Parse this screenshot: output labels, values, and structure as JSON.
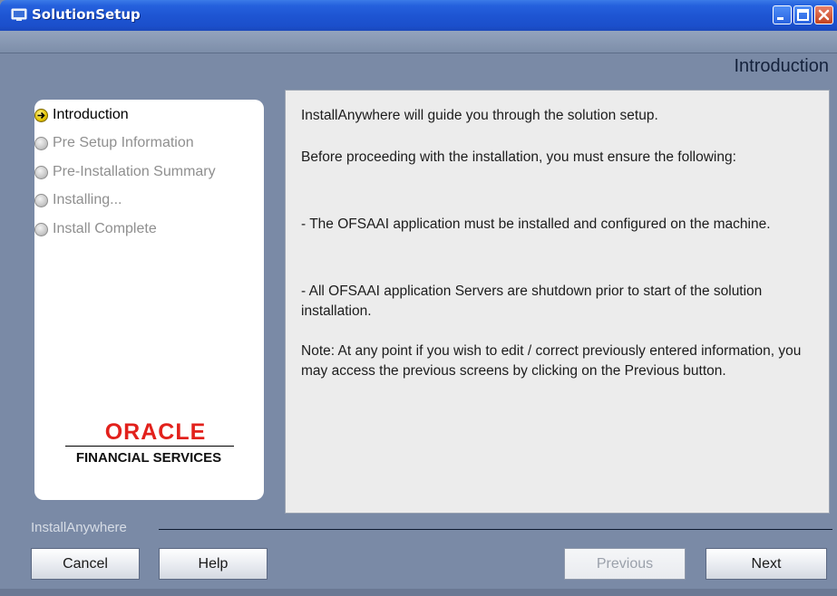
{
  "window": {
    "title": "SolutionSetup",
    "controls": [
      "minimize-icon",
      "maximize-icon",
      "close-icon"
    ]
  },
  "header": {
    "title": "Introduction"
  },
  "steps": [
    {
      "label": "Introduction",
      "state": "active"
    },
    {
      "label": "Pre Setup Information",
      "state": "pending"
    },
    {
      "label": "Pre-Installation Summary",
      "state": "pending"
    },
    {
      "label": "Installing...",
      "state": "pending"
    },
    {
      "label": "Install Complete",
      "state": "pending"
    }
  ],
  "logo": {
    "brand": "ORACLE",
    "tagline": "FINANCIAL SERVICES"
  },
  "content": {
    "paragraphs": [
      "InstallAnywhere will guide you through the solution setup.",
      "Before proceeding with the installation, you must ensure the following:",
      "- The OFSAAI application must be installed and configured on the machine.",
      "- All OFSAAI application Servers are shutdown prior to start of the solution installation.",
      "Note: At any point if you wish to edit / correct previously entered information, you may access the previous screens by clicking on the Previous button."
    ]
  },
  "footer": {
    "label": "InstallAnywhere",
    "cancel": "Cancel",
    "help": "Help",
    "previous": "Previous",
    "next": "Next"
  },
  "colors": {
    "titlebar": "#1e55d3",
    "background": "#7a8aa6",
    "oracle_red": "#e2211c"
  }
}
